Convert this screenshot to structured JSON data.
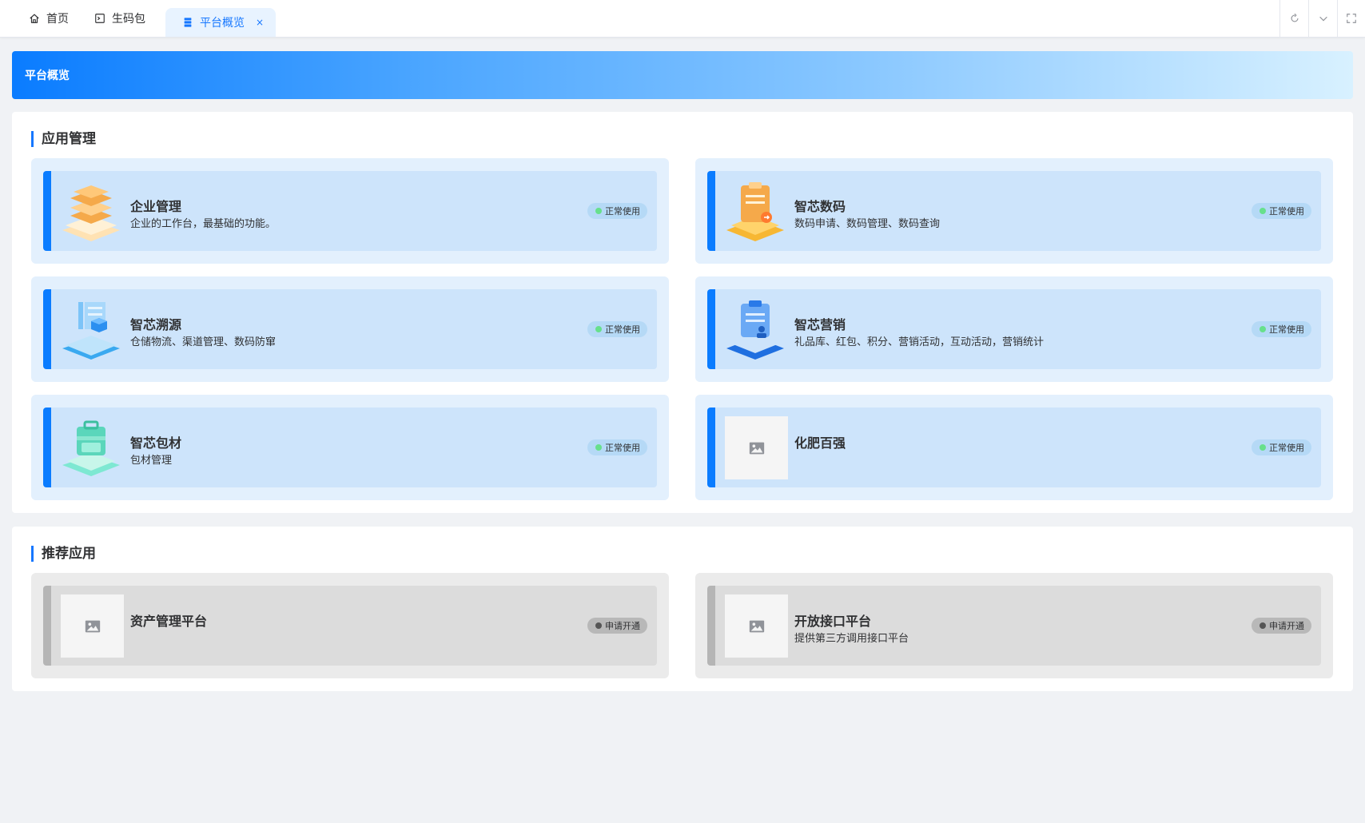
{
  "tabs": {
    "home": "首页",
    "package": "生码包",
    "active": "平台概览",
    "close": "×"
  },
  "page_title": "平台概览",
  "apps_section": {
    "title": "应用管理",
    "cards": [
      {
        "name": "企业管理",
        "desc": "企业的工作台，最基础的功能。",
        "status": "正常使用"
      },
      {
        "name": "智芯数码",
        "desc": "数码申请、数码管理、数码查询",
        "status": "正常使用"
      },
      {
        "name": "智芯溯源",
        "desc": "仓储物流、渠道管理、数码防窜",
        "status": "正常使用"
      },
      {
        "name": "智芯营销",
        "desc": "礼品库、红包、积分、营销活动，互动活动，营销统计",
        "status": "正常使用"
      },
      {
        "name": "智芯包材",
        "desc": "包材管理",
        "status": "正常使用"
      },
      {
        "name": "化肥百强",
        "desc": "",
        "status": "正常使用"
      }
    ]
  },
  "recommended_section": {
    "title": "推荐应用",
    "cards": [
      {
        "name": "资产管理平台",
        "desc": "",
        "status": "申请开通"
      },
      {
        "name": "开放接口平台",
        "desc": "提供第三方调用接口平台",
        "status": "申请开通"
      }
    ]
  },
  "colors": {
    "accent": "#1677ff",
    "card_bar": "#0a7cff",
    "status_ok": "#67e08c",
    "status_pending": "#555555"
  }
}
